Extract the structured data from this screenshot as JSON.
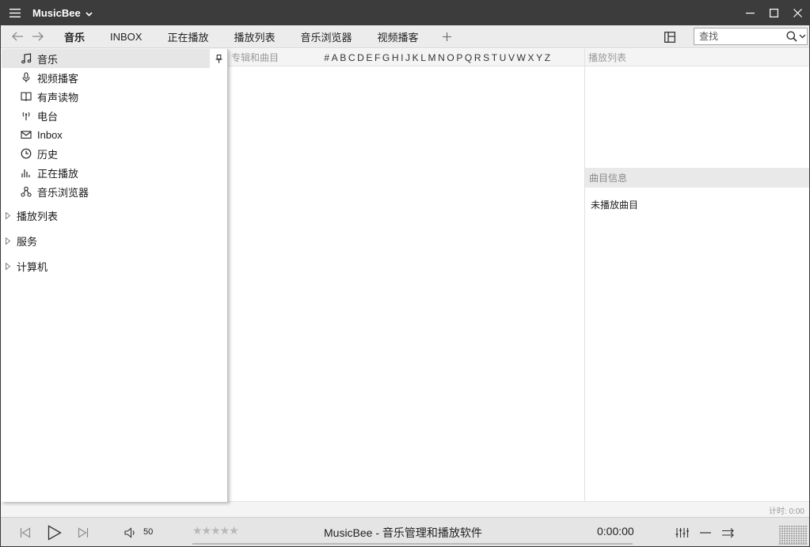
{
  "app": {
    "title": "MusicBee",
    "colors": {
      "titlebar": "#3c3c3c",
      "tabbar": "#ececec",
      "panel_bg": "#ffffff",
      "selected_row": "#e6e6e6",
      "header_text": "#9a9a9a"
    }
  },
  "tabs": [
    {
      "label": "音乐",
      "active": true
    },
    {
      "label": "INBOX",
      "active": false
    },
    {
      "label": "正在播放",
      "active": false
    },
    {
      "label": "播放列表",
      "active": false
    },
    {
      "label": "音乐浏览器",
      "active": false
    },
    {
      "label": "视频播客",
      "active": false
    }
  ],
  "search": {
    "placeholder": "查找"
  },
  "sidebar": {
    "items": [
      {
        "label": "音乐",
        "icon": "music-note-icon",
        "selected": true
      },
      {
        "label": "视频播客",
        "icon": "microphone-icon",
        "selected": false
      },
      {
        "label": "有声读物",
        "icon": "book-icon",
        "selected": false
      },
      {
        "label": "电台",
        "icon": "radio-antenna-icon",
        "selected": false
      },
      {
        "label": "Inbox",
        "icon": "mail-icon",
        "selected": false
      },
      {
        "label": "历史",
        "icon": "clock-icon",
        "selected": false
      },
      {
        "label": "正在播放",
        "icon": "bars-icon",
        "selected": false
      },
      {
        "label": "音乐浏览器",
        "icon": "network-icon",
        "selected": false
      }
    ],
    "groups": [
      {
        "label": "播放列表"
      },
      {
        "label": "服务"
      },
      {
        "label": "计算机"
      }
    ]
  },
  "main": {
    "header_label": "专辑和曲目",
    "alphabet": [
      "#",
      "A",
      "B",
      "C",
      "D",
      "E",
      "F",
      "G",
      "H",
      "I",
      "J",
      "K",
      "L",
      "M",
      "N",
      "O",
      "P",
      "Q",
      "R",
      "S",
      "T",
      "U",
      "V",
      "W",
      "X",
      "Y",
      "Z"
    ]
  },
  "right_panel": {
    "playlist_header": "播放列表",
    "track_info_header": "曲目信息",
    "track_info_text": "未播放曲目"
  },
  "status": {
    "timer": "计时: 0:00"
  },
  "player": {
    "volume": "50",
    "rating_stars": "★★★★★",
    "now_playing": "MusicBee - 音乐管理和播放软件",
    "time": "0:00:00"
  }
}
